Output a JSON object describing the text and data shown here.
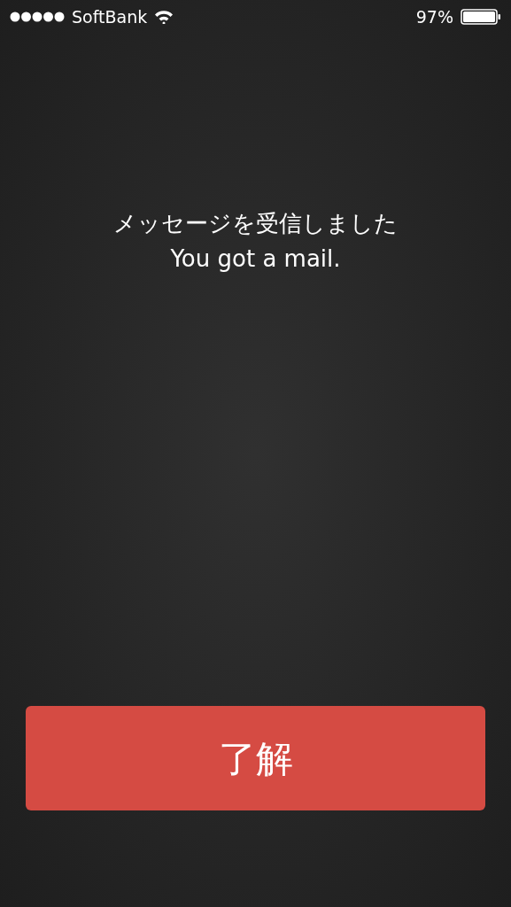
{
  "status_bar": {
    "carrier": "SoftBank",
    "battery": "97%"
  },
  "message": {
    "lines": [
      "メッセージを受信しました",
      "You got a mail."
    ]
  },
  "button": {
    "label": "了解"
  }
}
